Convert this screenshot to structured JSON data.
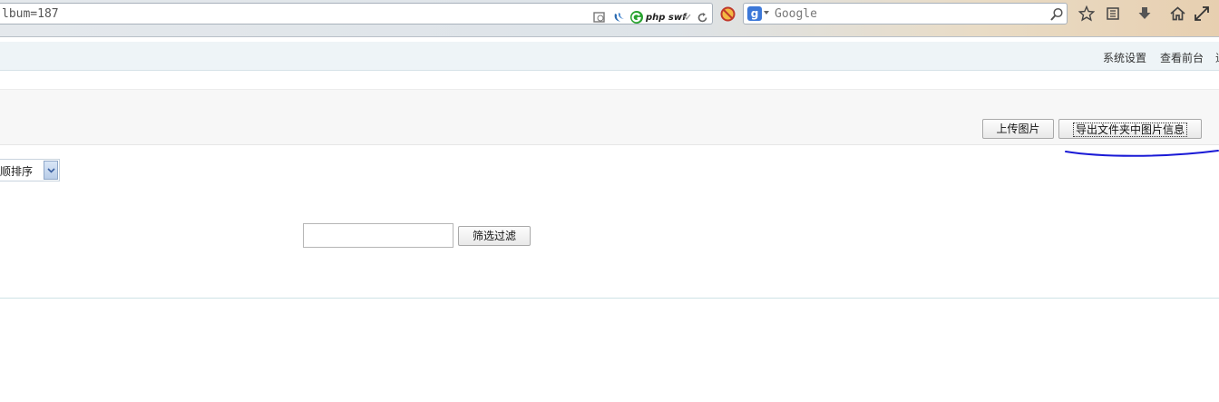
{
  "browser": {
    "url_fragment": "lbum=187",
    "toolbar_badges": {
      "php_swf": "php swf"
    },
    "search_placeholder": "Google",
    "search_engine_letter": "g"
  },
  "header": {
    "links": [
      "系统设置",
      "查看前台"
    ]
  },
  "actions": {
    "upload_label": "上传图片",
    "export_label": "导出文件夹中图片信息"
  },
  "sort": {
    "selected": "顺排序"
  },
  "filter": {
    "input_value": "",
    "button_label": "筛选过滤"
  },
  "colors": {
    "header_bg": "#eef4f7",
    "annotation_stroke": "#1a1ad6",
    "select_arrow": "#3a5fa0"
  }
}
